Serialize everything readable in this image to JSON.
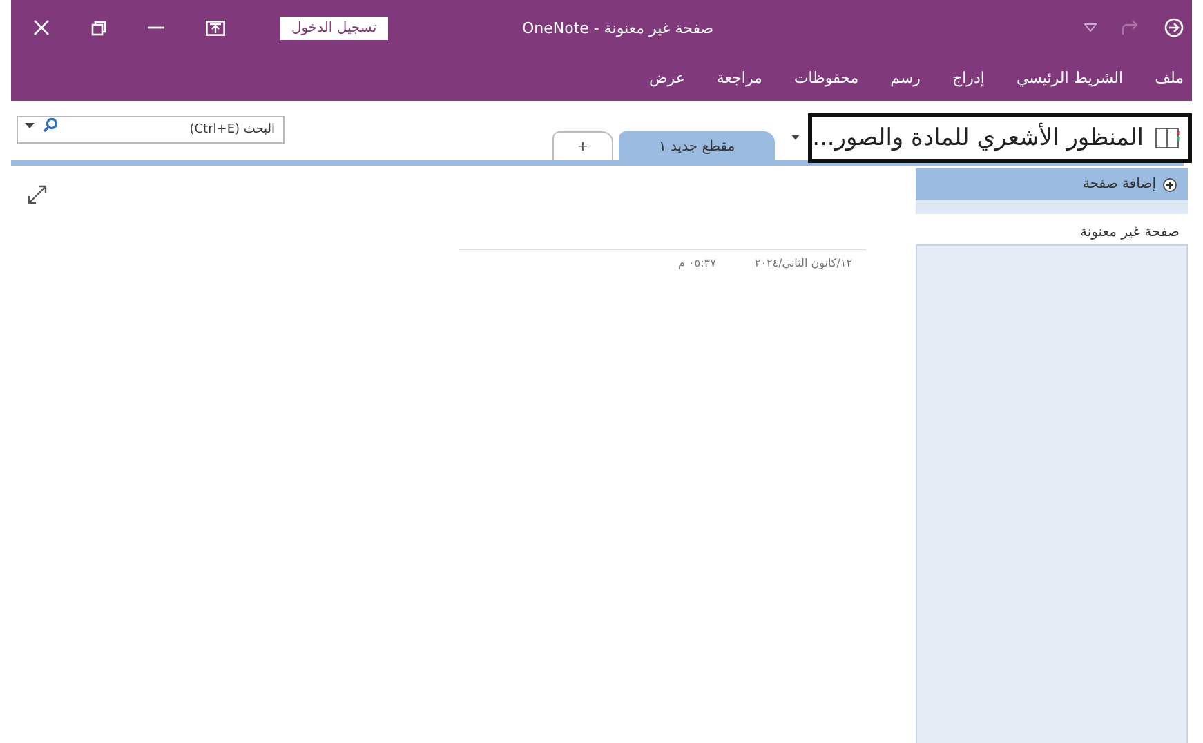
{
  "window": {
    "title": "صفحة غير معنونة  -  OneNote",
    "sign_in": "تسجيل الدخول"
  },
  "ribbon_tabs": [
    "ملف",
    "الشريط الرئيسي",
    "إدراج",
    "رسم",
    "محفوظات",
    "مراجعة",
    "عرض"
  ],
  "notebook": {
    "title": "المنظور الأشعري للمادة والصور..."
  },
  "sections": [
    {
      "label": "مقطع جديد ١",
      "selected": true
    },
    {
      "label": "+",
      "selected": false
    }
  ],
  "search": {
    "placeholder": "البحث (Ctrl+E)"
  },
  "pages_panel": {
    "add_page": "إضافة صفحة",
    "pages": [
      {
        "title": "صفحة غير معنونة"
      }
    ]
  },
  "note": {
    "date": "١٢/كانون الثاني/٢٠٢٤",
    "time": "٠٥:٣٧ م"
  }
}
